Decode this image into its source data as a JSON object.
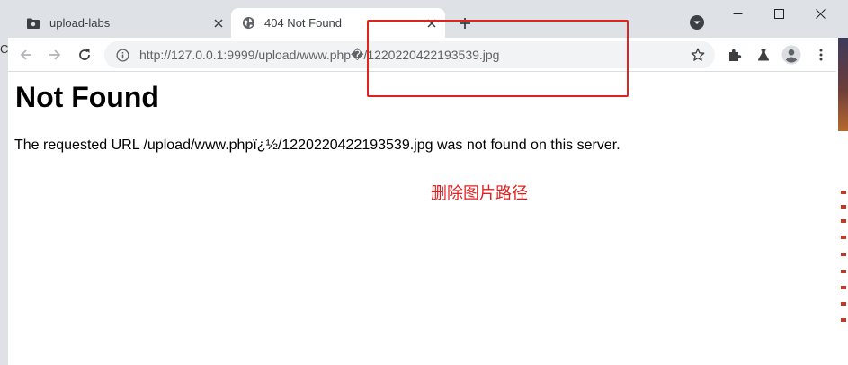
{
  "tabs": [
    {
      "title": "upload-labs",
      "favicon": "folder-icon",
      "active": false
    },
    {
      "title": "404 Not Found",
      "favicon": "globe-icon",
      "active": true
    }
  ],
  "address_bar": {
    "url": "http://127.0.0.1:9999/upload/www.php�/1220220422193539.jpg"
  },
  "page": {
    "heading": "Not Found",
    "message": "The requested URL /upload/www.phpï¿½/1220220422193539.jpg was not found on this server."
  },
  "annotation": {
    "text": "删除图片路径",
    "color": "#e02020"
  },
  "left_strip_glyph": "C",
  "colors": {
    "tabstrip": "#dee1e6",
    "highlight_box": "#e0231e"
  }
}
